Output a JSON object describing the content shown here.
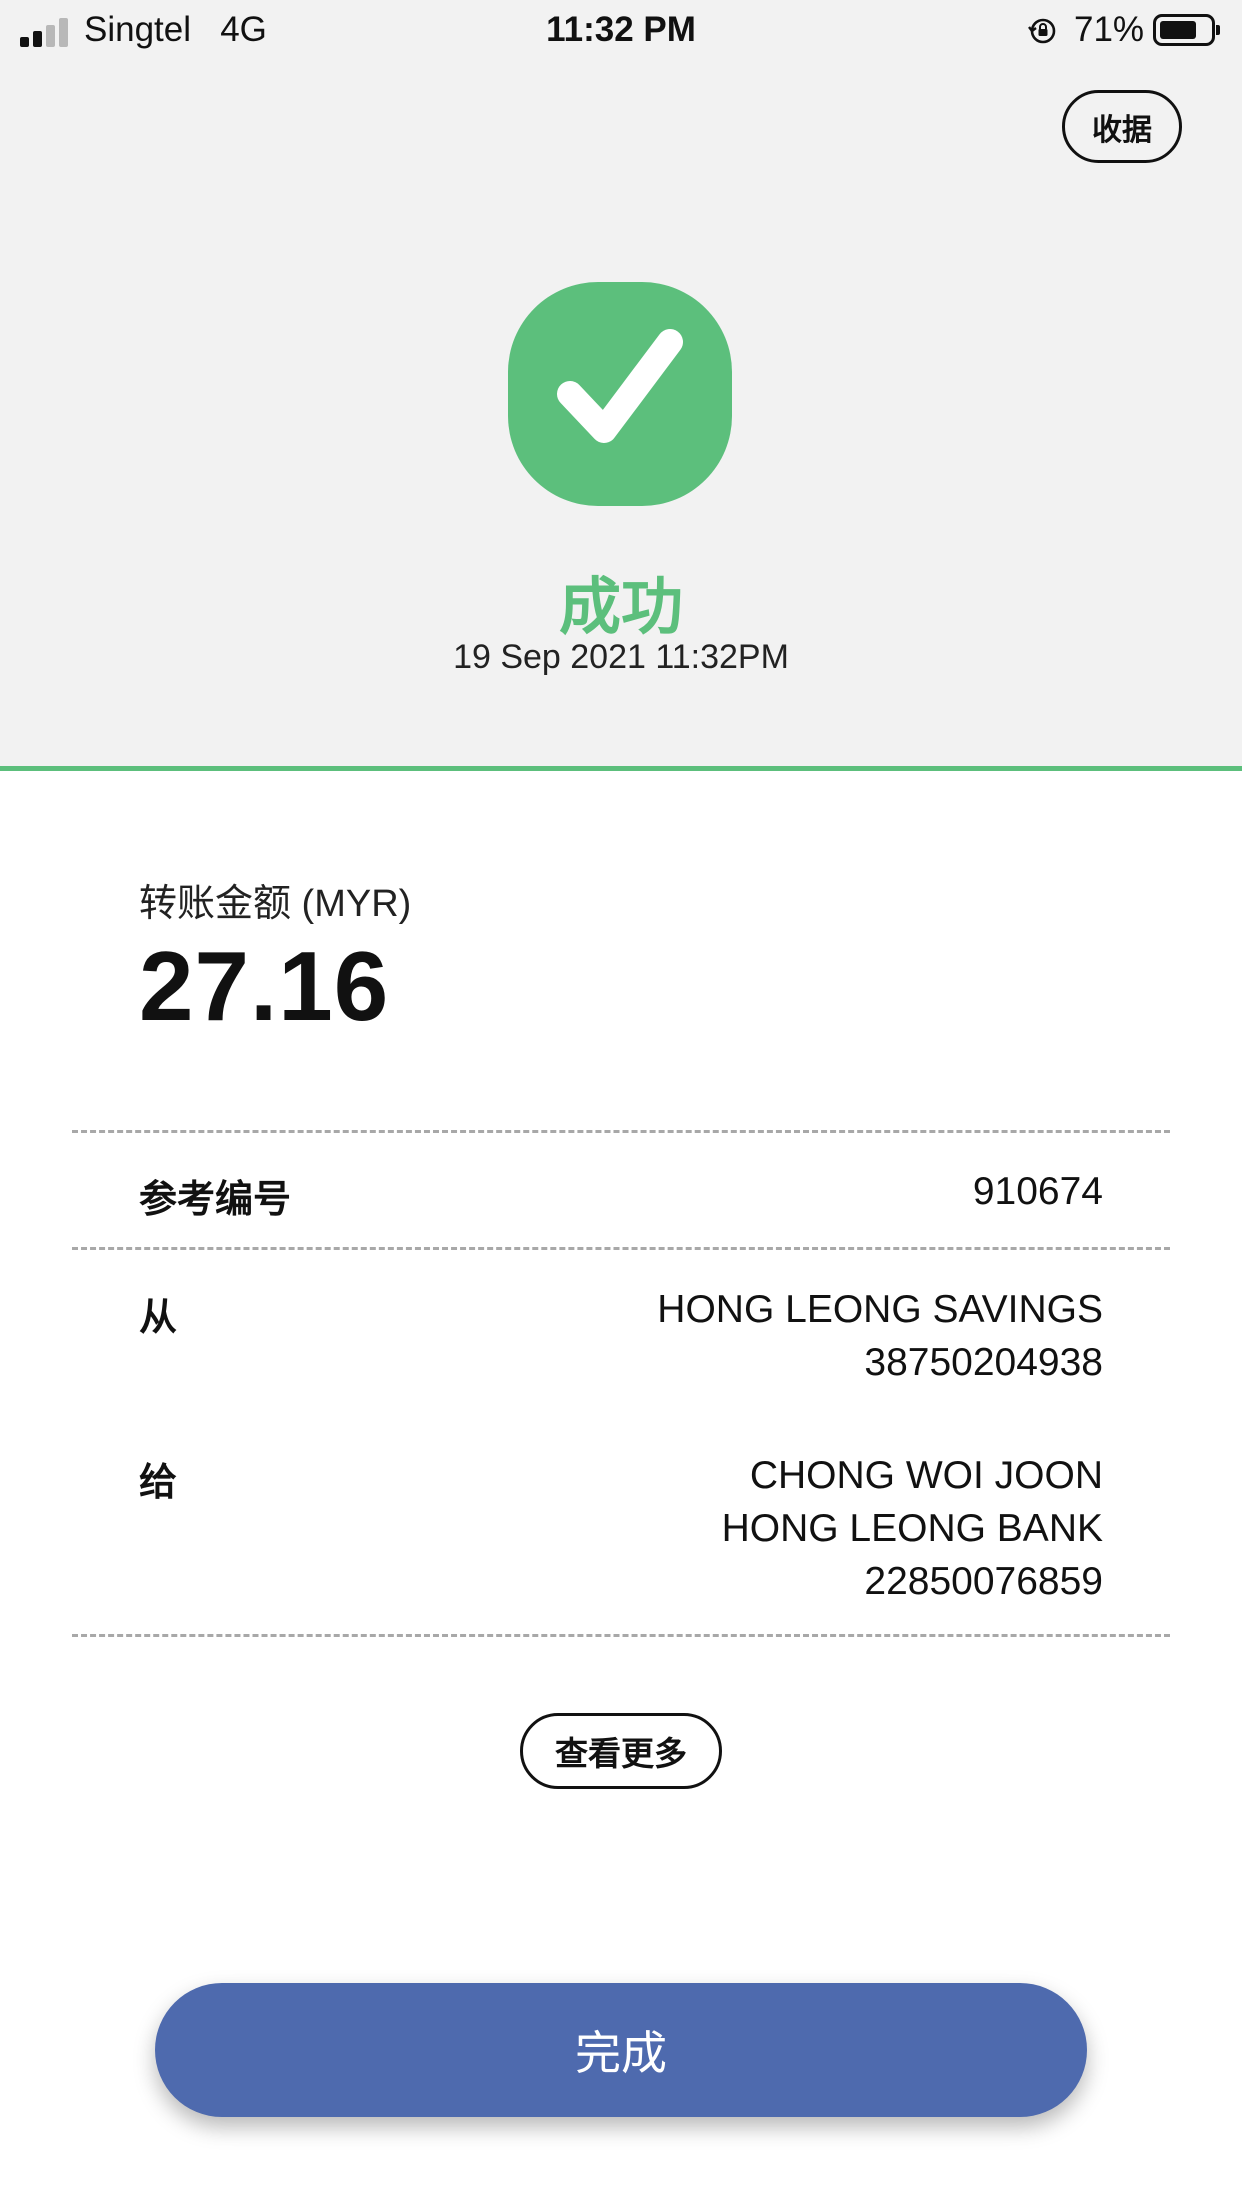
{
  "status_bar": {
    "carrier": "Singtel   4G",
    "time": "11:32 PM",
    "battery_percent": "71%",
    "battery_level": 0.71,
    "signal_bars_active": 2,
    "signal_bars_total": 4
  },
  "header": {
    "receipt_label": "收据"
  },
  "result": {
    "icon": "checkmark-icon",
    "status": "成功",
    "datetime": "19 Sep 2021 11:32PM",
    "accent_color": "#5cbf7c"
  },
  "transfer": {
    "amount_label": "转账金额 (MYR)",
    "amount": "27.16"
  },
  "details": {
    "reference": {
      "label": "参考编号",
      "value": "910674"
    },
    "from": {
      "label": "从",
      "account_name": "HONG LEONG SAVINGS",
      "account_number": "38750204938"
    },
    "to": {
      "label": "给",
      "recipient": "CHONG WOI JOON",
      "bank": "HONG LEONG BANK",
      "account_number": "22850076859"
    }
  },
  "actions": {
    "view_more_label": "查看更多",
    "done_label": "完成",
    "done_color": "#4e6aae"
  }
}
